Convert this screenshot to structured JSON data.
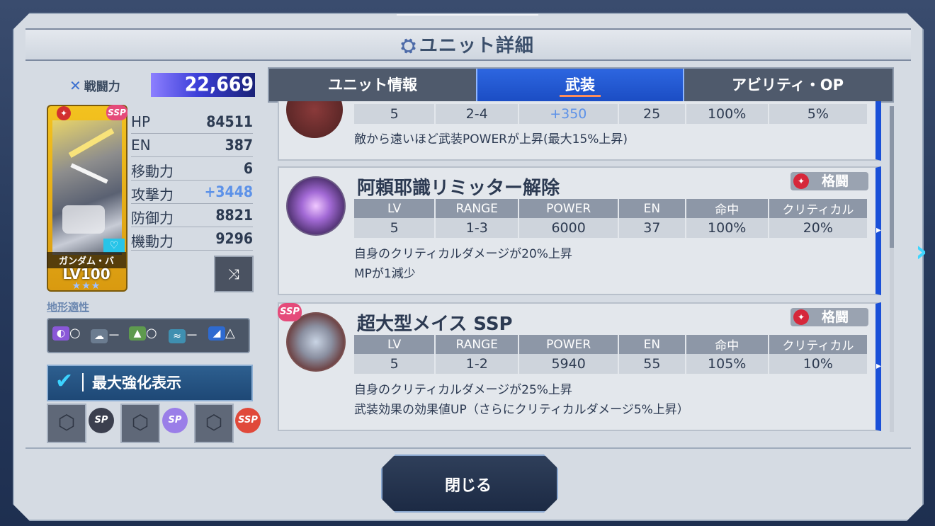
{
  "header": {
    "title": "ユニット詳細"
  },
  "unit": {
    "combat_power_label": "戦闘力",
    "combat_power": "22,669",
    "card_name": "ガンダム・バ",
    "level": "LV100",
    "stars": "★★★",
    "card_badge": "SSP"
  },
  "stats": [
    {
      "label": "HP",
      "value": "84511"
    },
    {
      "label": "EN",
      "value": "387"
    },
    {
      "label": "移動力",
      "value": "6"
    },
    {
      "label": "攻撃力",
      "value": "+3448"
    },
    {
      "label": "防御力",
      "value": "8821"
    },
    {
      "label": "機動力",
      "value": "9296"
    }
  ],
  "terrain": {
    "label": "地形適性",
    "items": [
      {
        "icon": "space-icon",
        "rating": "○"
      },
      {
        "icon": "air-icon",
        "rating": "－"
      },
      {
        "icon": "ground-icon",
        "rating": "○"
      },
      {
        "icon": "water-icon",
        "rating": "－"
      },
      {
        "icon": "underwater-icon",
        "rating": "△"
      }
    ]
  },
  "max_boost": {
    "label": "最大強化表示"
  },
  "slots": [
    {
      "badge": "SP"
    },
    {
      "badge": "SP"
    },
    {
      "badge": "SSP"
    }
  ],
  "tabs": [
    {
      "label": "ユニット情報"
    },
    {
      "label": "武装"
    },
    {
      "label": "アビリティ・OP"
    }
  ],
  "table_headers": [
    "LV",
    "RANGE",
    "POWER",
    "EN",
    "命中",
    "クリティカル"
  ],
  "weapons": [
    {
      "name": "",
      "type": "",
      "row": [
        "5",
        "2-4",
        "+350",
        "25",
        "100%",
        "5%"
      ],
      "desc": [
        "敵から遠いほど武装POWERが上昇(最大15%上昇)"
      ]
    },
    {
      "name": "阿頼耶識リミッター解除",
      "type": "格闘",
      "row": [
        "5",
        "1-3",
        "6000",
        "37",
        "100%",
        "20%"
      ],
      "desc": [
        "自身のクリティカルダメージが20%上昇",
        "MPが1減少"
      ]
    },
    {
      "name": "超大型メイス SSP",
      "type": "格闘",
      "row": [
        "5",
        "1-2",
        "5940",
        "55",
        "105%",
        "10%"
      ],
      "desc": [
        "自身のクリティカルダメージが25%上昇",
        "武装効果の効果値UP（さらにクリティカルダメージ5%上昇）"
      ]
    }
  ],
  "close_button": {
    "label": "閉じる"
  },
  "colors": {
    "accent": "#1b4dc4",
    "bonus": "#5d92e8"
  }
}
